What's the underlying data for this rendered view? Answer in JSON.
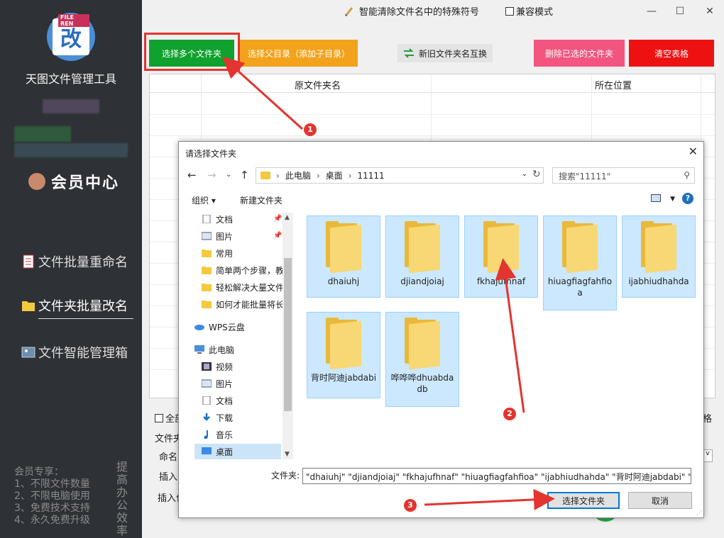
{
  "sidebar": {
    "app_title": "天图文件管理工具",
    "member_center": "会员中心",
    "nav": [
      {
        "label": "文件批量重命名",
        "icon": "document-icon"
      },
      {
        "label": "文件夹批量改名",
        "icon": "folder-icon"
      },
      {
        "label": "文件智能管理箱",
        "icon": "image-icon"
      }
    ],
    "promo_lines": [
      "会员专享：",
      "1、不限文件数量",
      "2、不限电脑使用",
      "3、免费技术支持",
      "4、永久免费升级"
    ],
    "promo_side": "提高办公效率",
    "logo_tag": "FILE REN",
    "logo_char": "改"
  },
  "topbar": {
    "title": "智能清除文件名中的特殊符号",
    "compat_label": "兼容模式",
    "minimize": "—",
    "maximize": "☐",
    "close": "✕"
  },
  "buttons": {
    "select_multiple": "选择多个文件夹",
    "select_parent": "选择父目录（添加子目录）",
    "swap": "新旧文件夹名互换",
    "delete_selected": "删除已选的文件夹",
    "clear_table": "清空表格"
  },
  "table": {
    "col_original": "原文件夹名",
    "col_location": "所在位置"
  },
  "bottom": {
    "select_all": "全部",
    "folder_label": "文件夹",
    "naming_label": "命名方",
    "insert1": "插入",
    "insert2": "插入位",
    "right_label": "格"
  },
  "dialog": {
    "title": "请选择文件夹",
    "close": "✕",
    "breadcrumb": [
      "此电脑",
      "桌面",
      "11111"
    ],
    "search_placeholder": "搜索\"11111\"",
    "organize": "组织 ▾",
    "new_folder": "新建文件夹",
    "help": "?",
    "tree": [
      {
        "label": "文档",
        "pinned": true,
        "icon": "document-icon"
      },
      {
        "label": "图片",
        "pinned": true,
        "icon": "picture-icon"
      },
      {
        "label": "常用",
        "pinned": false,
        "icon": "folder-icon"
      },
      {
        "label": "简单两个步骤，教",
        "pinned": false,
        "icon": "folder-icon"
      },
      {
        "label": "轻松解决大量文件",
        "pinned": false,
        "icon": "folder-icon"
      },
      {
        "label": "如何才能批量将长",
        "pinned": false,
        "icon": "folder-icon"
      },
      {
        "label": "WPS云盘",
        "pinned": false,
        "icon": "cloud-icon"
      },
      {
        "label": "此电脑",
        "pinned": false,
        "icon": "computer-icon"
      },
      {
        "label": "视频",
        "pinned": false,
        "icon": "video-icon"
      },
      {
        "label": "图片",
        "pinned": false,
        "icon": "picture-icon"
      },
      {
        "label": "文档",
        "pinned": false,
        "icon": "document-icon"
      },
      {
        "label": "下载",
        "pinned": false,
        "icon": "download-icon"
      },
      {
        "label": "音乐",
        "pinned": false,
        "icon": "music-icon"
      },
      {
        "label": "桌面",
        "pinned": false,
        "icon": "desktop-icon"
      }
    ],
    "folders": [
      "dhaiuhj",
      "djiandjoiaj",
      "fkhajufhnaf",
      "hiuagfiagfahfioa",
      "ijabhiudhahda",
      "背时阿迪jabdabi",
      "哗哗哗dhuabdadb"
    ],
    "filename_label": "文件夹:",
    "filename_value": "\"dhaiuhj\" \"djiandjoiaj\" \"fkhajufhnaf\" \"hiuagfiagfahfioa\" \"ijabhiudhahda\" \"背时阿迪jabdabi\" \"哗哗",
    "select_button": "选择文件夹",
    "cancel_button": "取消"
  },
  "markers": [
    "1",
    "2",
    "3"
  ],
  "colors": {
    "select_multiple": "#10a12e",
    "select_parent": "#f2a31b",
    "delete_selected": "#f2557f",
    "clear_table": "#ee1111",
    "annotation": "#e3342f"
  }
}
